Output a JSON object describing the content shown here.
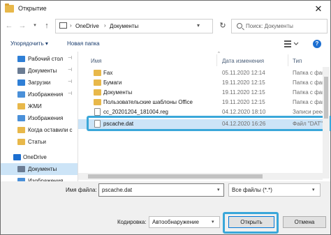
{
  "window": {
    "title": "Открытие",
    "close_glyph": "✕"
  },
  "address": {
    "path": [
      "OneDrive",
      "Документы"
    ],
    "separator": "›",
    "search_placeholder": "Поиск: Документы"
  },
  "toolbar": {
    "organize_label": "Упорядочить ▾",
    "new_folder_label": "Новая папка",
    "help_label": "?"
  },
  "sidebar": {
    "items": [
      {
        "label": "Рабочий стол",
        "icon": "desktop-icon",
        "color": "#2f7fd6",
        "pinned": true
      },
      {
        "label": "Документы",
        "icon": "documents-icon",
        "color": "#6b7c93",
        "pinned": true
      },
      {
        "label": "Загрузки",
        "icon": "downloads-icon",
        "color": "#2f7fd6",
        "pinned": true
      },
      {
        "label": "Изображения",
        "icon": "pictures-icon",
        "color": "#4a90d9",
        "pinned": true
      },
      {
        "label": "ЖМИ",
        "icon": "folder-icon",
        "color": "#e8b84a",
        "pinned": false
      },
      {
        "label": "Изображения",
        "icon": "pictures-icon",
        "color": "#4a90d9",
        "pinned": false
      },
      {
        "label": "Когда оставили с",
        "icon": "folder-icon",
        "color": "#e8b84a",
        "pinned": false
      },
      {
        "label": "Статьи",
        "icon": "folder-icon",
        "color": "#e8b84a",
        "pinned": false
      },
      {
        "label": "OneDrive",
        "icon": "onedrive-icon",
        "color": "#1c6fd1",
        "pinned": false
      },
      {
        "label": "Документы",
        "icon": "documents-icon",
        "color": "#6b7c93",
        "pinned": false
      },
      {
        "label": "Изображения",
        "icon": "pictures-icon",
        "color": "#4a90d9",
        "pinned": false
      }
    ],
    "pin_glyph": "📌"
  },
  "filelist": {
    "columns": {
      "name": "Имя",
      "date": "Дата изменения",
      "type": "Тип"
    },
    "rows": [
      {
        "name": "Fax",
        "date": "05.11.2020 12:14",
        "type": "Папка с файл",
        "kind": "folder"
      },
      {
        "name": "Бумаги",
        "date": "19.11.2020 12:15",
        "type": "Папка с файл",
        "kind": "folder"
      },
      {
        "name": "Документы",
        "date": "19.11.2020 12:15",
        "type": "Папка с файл",
        "kind": "folder"
      },
      {
        "name": "Пользовательские шаблоны Office",
        "date": "19.11.2020 12:15",
        "type": "Папка с файл",
        "kind": "folder"
      },
      {
        "name": "cc_20201204_181004.reg",
        "date": "04.12.2020 18:10",
        "type": "Записи реестр",
        "kind": "file"
      },
      {
        "name": "pscache.dat",
        "date": "04.12.2020 16:26",
        "type": "Файл \"DAT\"",
        "kind": "file"
      }
    ]
  },
  "bottom": {
    "filename_label": "Имя файла:",
    "filename_value": "pscache.dat",
    "filter_value": "Все файлы (*.*)",
    "encoding_label": "Кодировка:",
    "encoding_value": "Автообнаружение",
    "open_label": "Открыть",
    "cancel_label": "Отмена"
  },
  "colors": {
    "selection": "#cce4f7",
    "highlight_frame": "#3aa7d9",
    "accent": "#0078d7"
  }
}
